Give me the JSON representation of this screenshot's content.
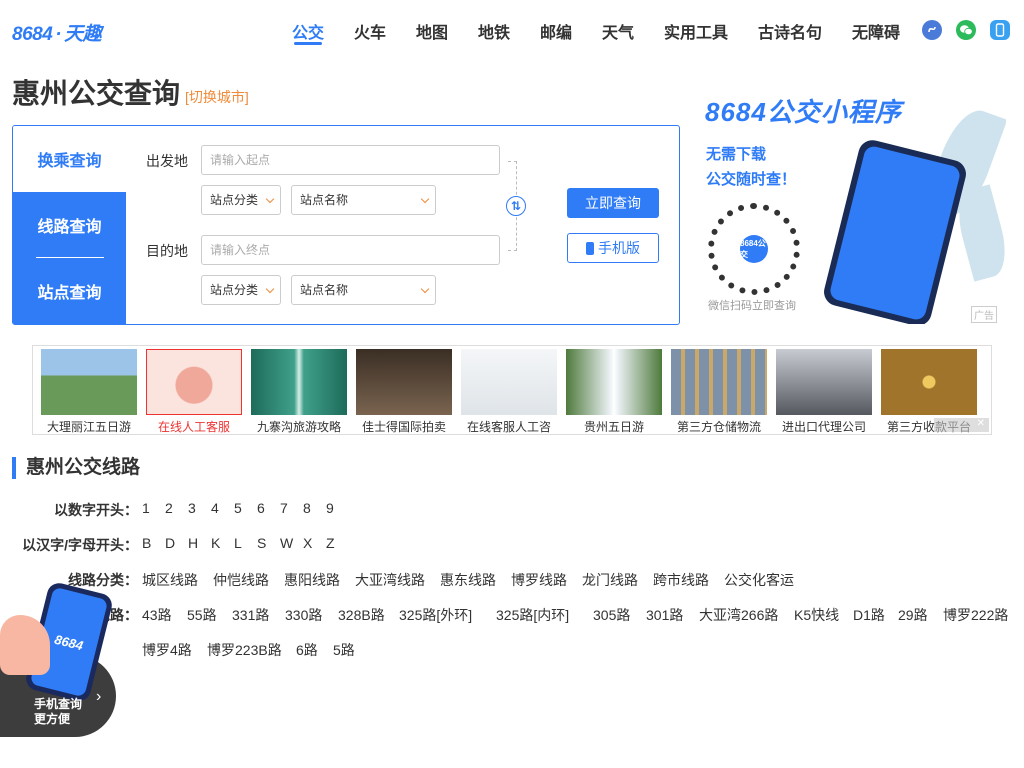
{
  "header": {
    "logo": {
      "brand": "8684",
      "separator": "·",
      "sub": "天趣"
    },
    "nav": [
      {
        "label": "公交",
        "active": true
      },
      {
        "label": "火车",
        "active": false
      },
      {
        "label": "地图",
        "active": false
      },
      {
        "label": "地铁",
        "active": false
      },
      {
        "label": "邮编",
        "active": false
      },
      {
        "label": "天气",
        "active": false
      },
      {
        "label": "实用工具",
        "active": false
      },
      {
        "label": "古诗名句",
        "active": false
      },
      {
        "label": "无障碍",
        "active": false
      }
    ],
    "icons": [
      "mini-program-icon",
      "wechat-icon",
      "mobile-icon"
    ]
  },
  "page": {
    "title": "惠州公交查询",
    "switch_city": "[切换城市]"
  },
  "query": {
    "tabs": [
      "换乘查询",
      "线路查询",
      "站点查询"
    ],
    "from_label": "出发地",
    "from_placeholder": "请输入起点",
    "to_label": "目的地",
    "to_placeholder": "请输入终点",
    "category_select": "站点分类",
    "name_select": "站点名称",
    "swap_glyph": "⇅",
    "submit": "立即查询",
    "mobile": "手机版"
  },
  "ad_right": {
    "title": "8684公交小程序",
    "line1": "无需下载",
    "line2": "公交随时查！",
    "qr_label": "8684公交",
    "caption": "微信扫码立即查询",
    "tag": "广告"
  },
  "strip": {
    "items": [
      {
        "caption": "大理丽江五日游",
        "highlight": false,
        "color": "#6a9a5a"
      },
      {
        "caption": "在线人工客服",
        "highlight": true,
        "color": "#f0c8c0"
      },
      {
        "caption": "九寨沟旅游攻略",
        "highlight": false,
        "color": "#2e8a7a"
      },
      {
        "caption": "佳士得国际拍卖",
        "highlight": false,
        "color": "#5a4a3a"
      },
      {
        "caption": "在线客服人工咨",
        "highlight": false,
        "color": "#e8ecef"
      },
      {
        "caption": "贵州五日游",
        "highlight": false,
        "color": "#5e8a4a"
      },
      {
        "caption": "第三方仓储物流",
        "highlight": false,
        "color": "#8a9fb5"
      },
      {
        "caption": "进出口代理公司",
        "highlight": false,
        "color": "#7a7f88"
      },
      {
        "caption": "第三方收款平台",
        "highlight": false,
        "color": "#b08a3a"
      }
    ],
    "close": "✕"
  },
  "lines": {
    "title": "惠州公交线路",
    "rows": [
      {
        "label": "以数字开头：",
        "items": [
          "1",
          "2",
          "3",
          "4",
          "5",
          "6",
          "7",
          "8",
          "9"
        ]
      },
      {
        "label": "以汉字/字母开头：",
        "items": [
          "B",
          "D",
          "H",
          "K",
          "L",
          "S",
          "W",
          "X",
          "Z"
        ]
      },
      {
        "label": "线路分类：",
        "items": [
          "城区线路",
          "仲恺线路",
          "惠阳线路",
          "大亚湾线路",
          "惠东线路",
          "博罗线路",
          "龙门线路",
          "跨市线路",
          "公交化客运"
        ]
      },
      {
        "label": "热门线路：",
        "items": [
          "43路",
          "55路",
          "331路",
          "330路",
          "328B路",
          "325路[外环]",
          "325路[内环]",
          "305路",
          "301路",
          "大亚湾266路",
          "K5快线",
          "D1路",
          "29路",
          "博罗222路"
        ]
      },
      {
        "label": "",
        "items": [
          "博罗4路",
          "博罗223B路",
          "6路",
          "5路"
        ]
      }
    ]
  },
  "float_promo": {
    "phone_text": "8684",
    "line1": "手机查询",
    "line2": "更方便",
    "arrow": "›"
  }
}
